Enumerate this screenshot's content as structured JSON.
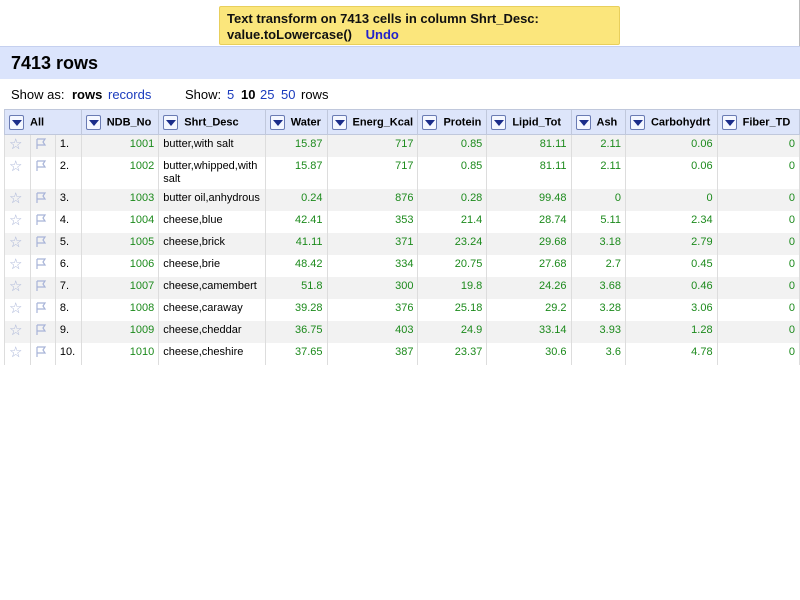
{
  "notification": {
    "message_line1": "Text transform on 7413 cells in column Shrt_Desc:",
    "message_line2": "value.toLowercase()",
    "undo": "Undo"
  },
  "summary": {
    "rows_count": "7413 rows"
  },
  "view_controls": {
    "show_as_label": "Show as:",
    "rows_option": "rows",
    "records_option": "records",
    "show_label": "Show:",
    "page_sizes": [
      "5",
      "10",
      "25",
      "50"
    ],
    "selected_page_size": "10",
    "rows_suffix": "rows"
  },
  "columns": {
    "all": "All",
    "ndb_no": "NDB_No",
    "shrt_desc": "Shrt_Desc",
    "water": "Water",
    "energ_kcal": "Energ_Kcal",
    "protein": "Protein",
    "lipid_tot": "Lipid_Tot",
    "ash": "Ash",
    "carbohydrt": "Carbohydrt",
    "fiber_td": "Fiber_TD"
  },
  "icons": {
    "star": "star-icon",
    "flag": "flag-icon",
    "dropdown": "dropdown-arrow-icon"
  },
  "colors": {
    "number_green": "#1c8a1c",
    "header_blue": "#dbe4fc",
    "notification_yellow": "#fbe67c",
    "link_blue": "#1a3bbd"
  },
  "rows": [
    {
      "idx": "1.",
      "ndb": "1001",
      "desc": "butter,with salt",
      "water": "15.87",
      "kcal": "717",
      "protein": "0.85",
      "lipid": "81.11",
      "ash": "2.11",
      "carb": "0.06",
      "fiber": "0"
    },
    {
      "idx": "2.",
      "ndb": "1002",
      "desc": "butter,whipped,with salt",
      "water": "15.87",
      "kcal": "717",
      "protein": "0.85",
      "lipid": "81.11",
      "ash": "2.11",
      "carb": "0.06",
      "fiber": "0"
    },
    {
      "idx": "3.",
      "ndb": "1003",
      "desc": "butter oil,anhydrous",
      "water": "0.24",
      "kcal": "876",
      "protein": "0.28",
      "lipid": "99.48",
      "ash": "0",
      "carb": "0",
      "fiber": "0"
    },
    {
      "idx": "4.",
      "ndb": "1004",
      "desc": "cheese,blue",
      "water": "42.41",
      "kcal": "353",
      "protein": "21.4",
      "lipid": "28.74",
      "ash": "5.11",
      "carb": "2.34",
      "fiber": "0"
    },
    {
      "idx": "5.",
      "ndb": "1005",
      "desc": "cheese,brick",
      "water": "41.11",
      "kcal": "371",
      "protein": "23.24",
      "lipid": "29.68",
      "ash": "3.18",
      "carb": "2.79",
      "fiber": "0"
    },
    {
      "idx": "6.",
      "ndb": "1006",
      "desc": "cheese,brie",
      "water": "48.42",
      "kcal": "334",
      "protein": "20.75",
      "lipid": "27.68",
      "ash": "2.7",
      "carb": "0.45",
      "fiber": "0"
    },
    {
      "idx": "7.",
      "ndb": "1007",
      "desc": "cheese,camembert",
      "water": "51.8",
      "kcal": "300",
      "protein": "19.8",
      "lipid": "24.26",
      "ash": "3.68",
      "carb": "0.46",
      "fiber": "0"
    },
    {
      "idx": "8.",
      "ndb": "1008",
      "desc": "cheese,caraway",
      "water": "39.28",
      "kcal": "376",
      "protein": "25.18",
      "lipid": "29.2",
      "ash": "3.28",
      "carb": "3.06",
      "fiber": "0"
    },
    {
      "idx": "9.",
      "ndb": "1009",
      "desc": "cheese,cheddar",
      "water": "36.75",
      "kcal": "403",
      "protein": "24.9",
      "lipid": "33.14",
      "ash": "3.93",
      "carb": "1.28",
      "fiber": "0"
    },
    {
      "idx": "10.",
      "ndb": "1010",
      "desc": "cheese,cheshire",
      "water": "37.65",
      "kcal": "387",
      "protein": "23.37",
      "lipid": "30.6",
      "ash": "3.6",
      "carb": "4.78",
      "fiber": "0"
    }
  ]
}
